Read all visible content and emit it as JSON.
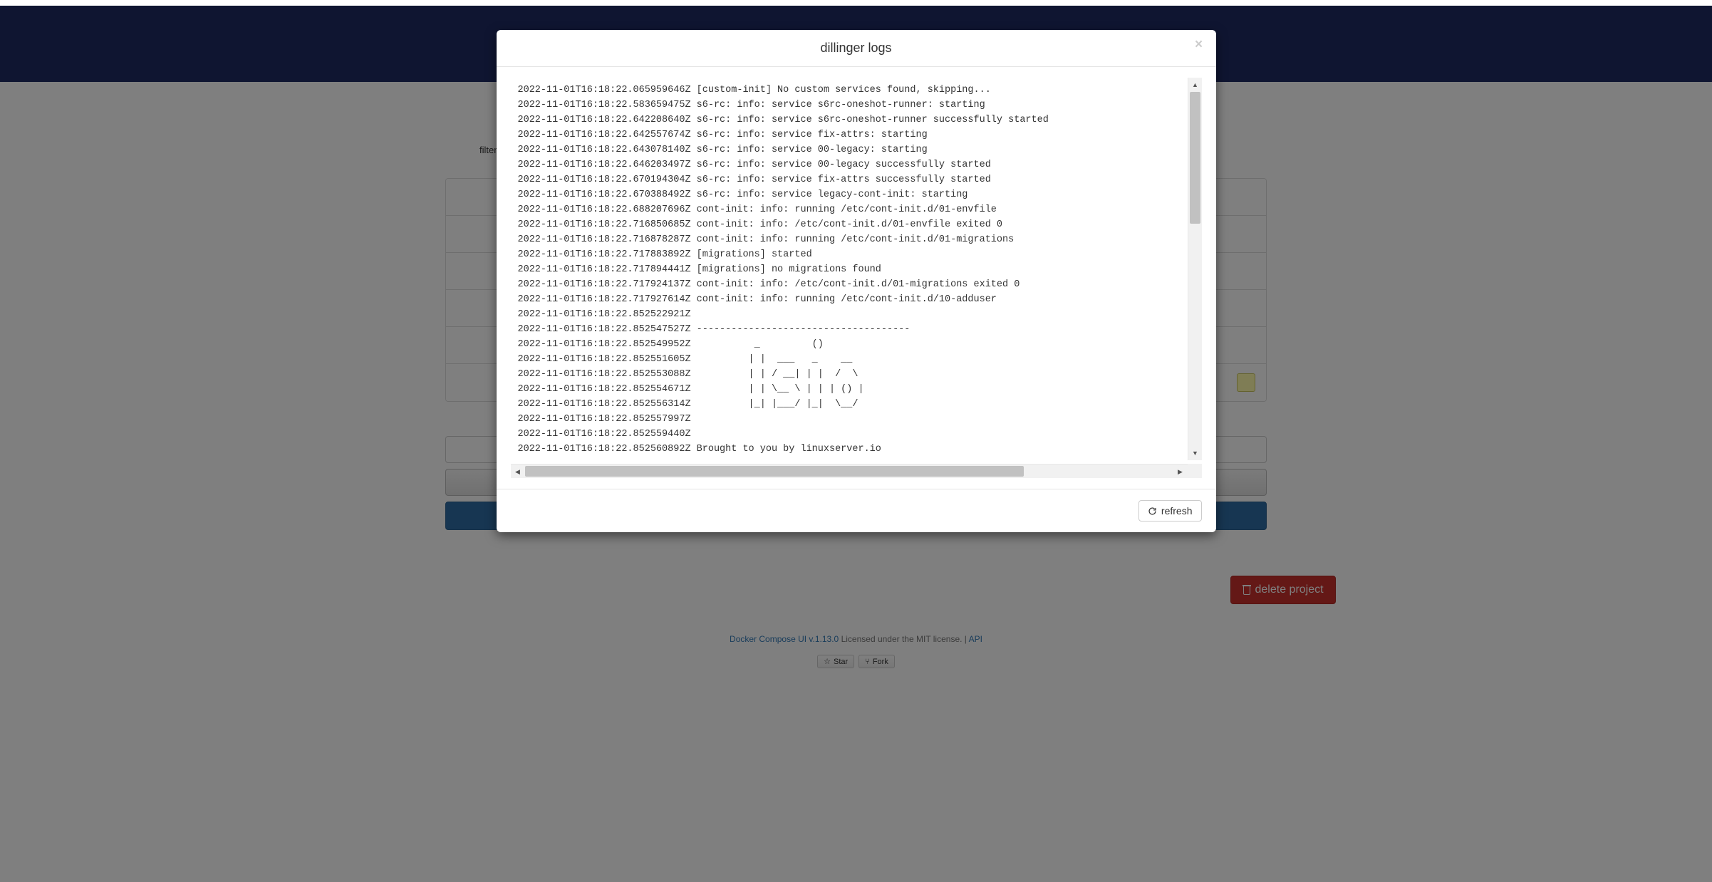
{
  "page": {
    "filter_label": "filter:",
    "filter_value": "",
    "delete_project_label": "delete project"
  },
  "footer": {
    "link_text": "Docker Compose UI v.1.13.0",
    "license_text": "Licensed under the MIT license.",
    "sep": " | ",
    "api_link": "API",
    "star_label": "Star",
    "fork_label": "Fork"
  },
  "modal": {
    "title": "dillinger logs",
    "close_label": "×",
    "refresh_label": "refresh",
    "logs": "2022-11-01T16:18:22.065959646Z [custom-init] No custom services found, skipping...\n2022-11-01T16:18:22.583659475Z s6-rc: info: service s6rc-oneshot-runner: starting\n2022-11-01T16:18:22.642208640Z s6-rc: info: service s6rc-oneshot-runner successfully started\n2022-11-01T16:18:22.642557674Z s6-rc: info: service fix-attrs: starting\n2022-11-01T16:18:22.643078140Z s6-rc: info: service 00-legacy: starting\n2022-11-01T16:18:22.646203497Z s6-rc: info: service 00-legacy successfully started\n2022-11-01T16:18:22.670194304Z s6-rc: info: service fix-attrs successfully started\n2022-11-01T16:18:22.670388492Z s6-rc: info: service legacy-cont-init: starting\n2022-11-01T16:18:22.688207696Z cont-init: info: running /etc/cont-init.d/01-envfile\n2022-11-01T16:18:22.716850685Z cont-init: info: /etc/cont-init.d/01-envfile exited 0\n2022-11-01T16:18:22.716878287Z cont-init: info: running /etc/cont-init.d/01-migrations\n2022-11-01T16:18:22.717883892Z [migrations] started\n2022-11-01T16:18:22.717894441Z [migrations] no migrations found\n2022-11-01T16:18:22.717924137Z cont-init: info: /etc/cont-init.d/01-migrations exited 0\n2022-11-01T16:18:22.717927614Z cont-init: info: running /etc/cont-init.d/10-adduser\n2022-11-01T16:18:22.852522921Z \n2022-11-01T16:18:22.852547527Z -------------------------------------\n2022-11-01T16:18:22.852549952Z           _         ()\n2022-11-01T16:18:22.852551605Z          | |  ___   _    __\n2022-11-01T16:18:22.852553088Z          | | / __| | |  /  \\ \n2022-11-01T16:18:22.852554671Z          | | \\__ \\ | | | () |\n2022-11-01T16:18:22.852556314Z          |_| |___/ |_|  \\__/\n2022-11-01T16:18:22.852557997Z \n2022-11-01T16:18:22.852559440Z \n2022-11-01T16:18:22.852560892Z Brought to you by linuxserver.io"
  }
}
